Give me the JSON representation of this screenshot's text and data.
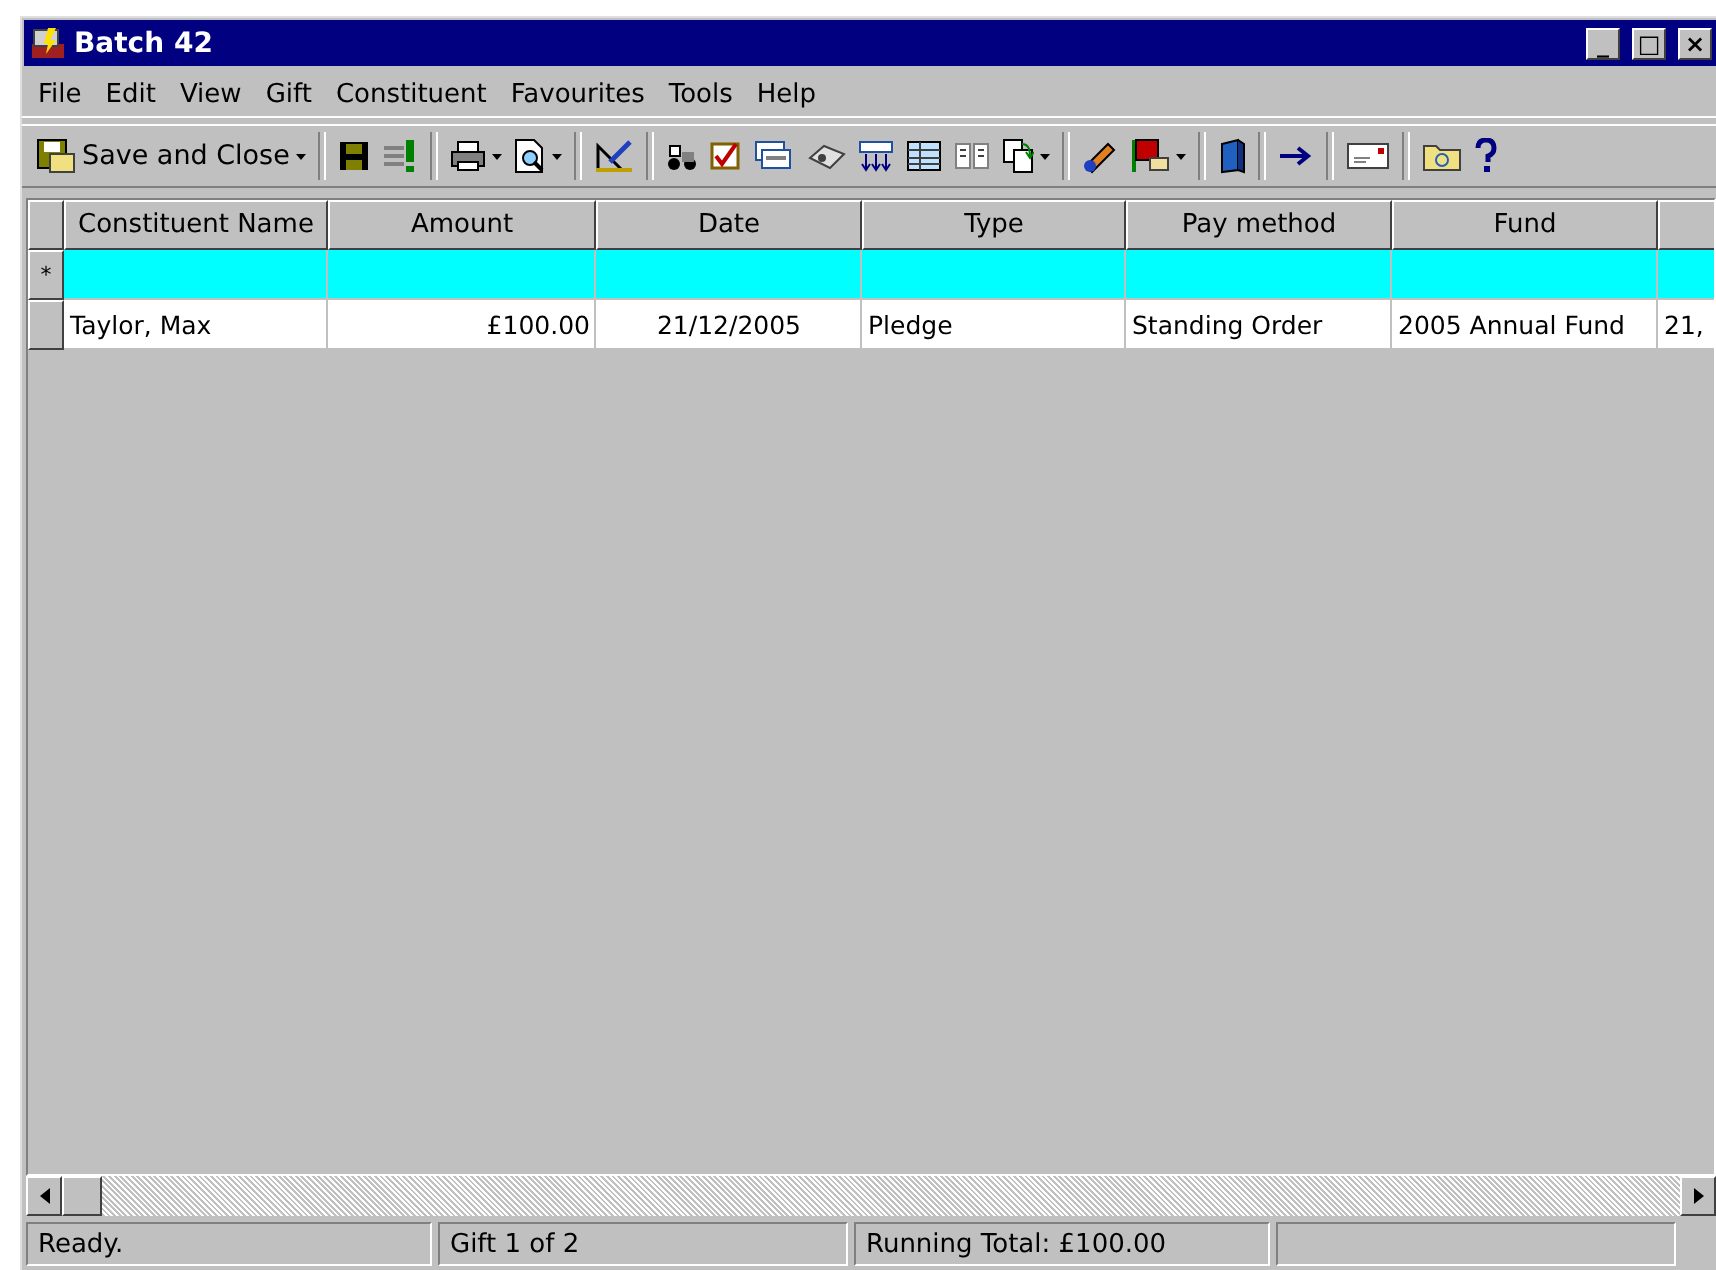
{
  "window": {
    "title": "Batch 42",
    "controls": [
      "_",
      "□",
      "×"
    ]
  },
  "menu": [
    "File",
    "Edit",
    "View",
    "Gift",
    "Constituent",
    "Favourites",
    "Tools",
    "Help"
  ],
  "toolbar": {
    "save_close": {
      "label": "Save and Close",
      "dropdown": true
    },
    "groups": [
      [
        {
          "dropdown": false
        },
        {
          "dropdown": false
        }
      ],
      [
        {
          "dropdown": true
        },
        {
          "dropdown": true
        }
      ],
      [
        {
          "dropdown": false
        }
      ],
      [
        {
          "dropdown": false
        },
        {
          "dropdown": false
        },
        {
          "dropdown": false
        },
        {
          "dropdown": false
        },
        {
          "dropdown": false
        },
        {
          "dropdown": false
        },
        {
          "dropdown": false
        },
        {
          "dropdown": true
        }
      ],
      [
        {
          "dropdown": false
        },
        {
          "dropdown": true
        }
      ],
      [
        {
          "dropdown": false
        }
      ],
      [
        {
          "dropdown": false
        }
      ],
      [
        {
          "dropdown": false
        }
      ],
      [
        {
          "dropdown": false
        },
        {
          "dropdown": false
        }
      ]
    ]
  },
  "grid": {
    "columns": [
      "Constituent Name",
      "Amount",
      "Date",
      "Type",
      "Pay method",
      "Fund"
    ],
    "rows": [
      {
        "kind": "new",
        "marker": "*",
        "selected": true,
        "cells": []
      },
      {
        "kind": "data",
        "selected": false,
        "cells": [
          "Taylor, Max",
          "£100.00",
          "21/12/2005",
          "Pledge",
          "Standing Order",
          "2005 Annual Fund",
          "21,"
        ]
      }
    ]
  },
  "status_bar": [
    "Ready.",
    "Gift 1 of 2",
    "Running Total: £100.00"
  ]
}
